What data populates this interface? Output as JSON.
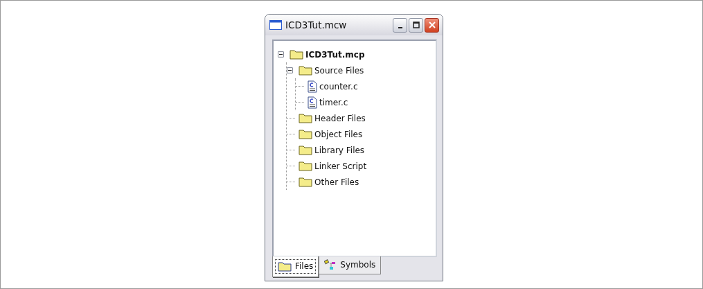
{
  "window": {
    "title": "ICD3Tut.mcw"
  },
  "tree": [
    {
      "label": "ICD3Tut.mcp",
      "kind": "project",
      "expanded": true,
      "children": [
        {
          "label": "Source Files",
          "kind": "folder",
          "expanded": true,
          "children": [
            {
              "label": "counter.c",
              "kind": "file"
            },
            {
              "label": "timer.c",
              "kind": "file"
            }
          ]
        },
        {
          "label": "Header Files",
          "kind": "folder"
        },
        {
          "label": "Object Files",
          "kind": "folder"
        },
        {
          "label": "Library Files",
          "kind": "folder"
        },
        {
          "label": "Linker Script",
          "kind": "folder"
        },
        {
          "label": "Other Files",
          "kind": "folder"
        }
      ]
    }
  ],
  "tabs": [
    {
      "label": "Files",
      "kind": "files",
      "selected": true
    },
    {
      "label": "Symbols",
      "kind": "symbols",
      "selected": false
    }
  ]
}
